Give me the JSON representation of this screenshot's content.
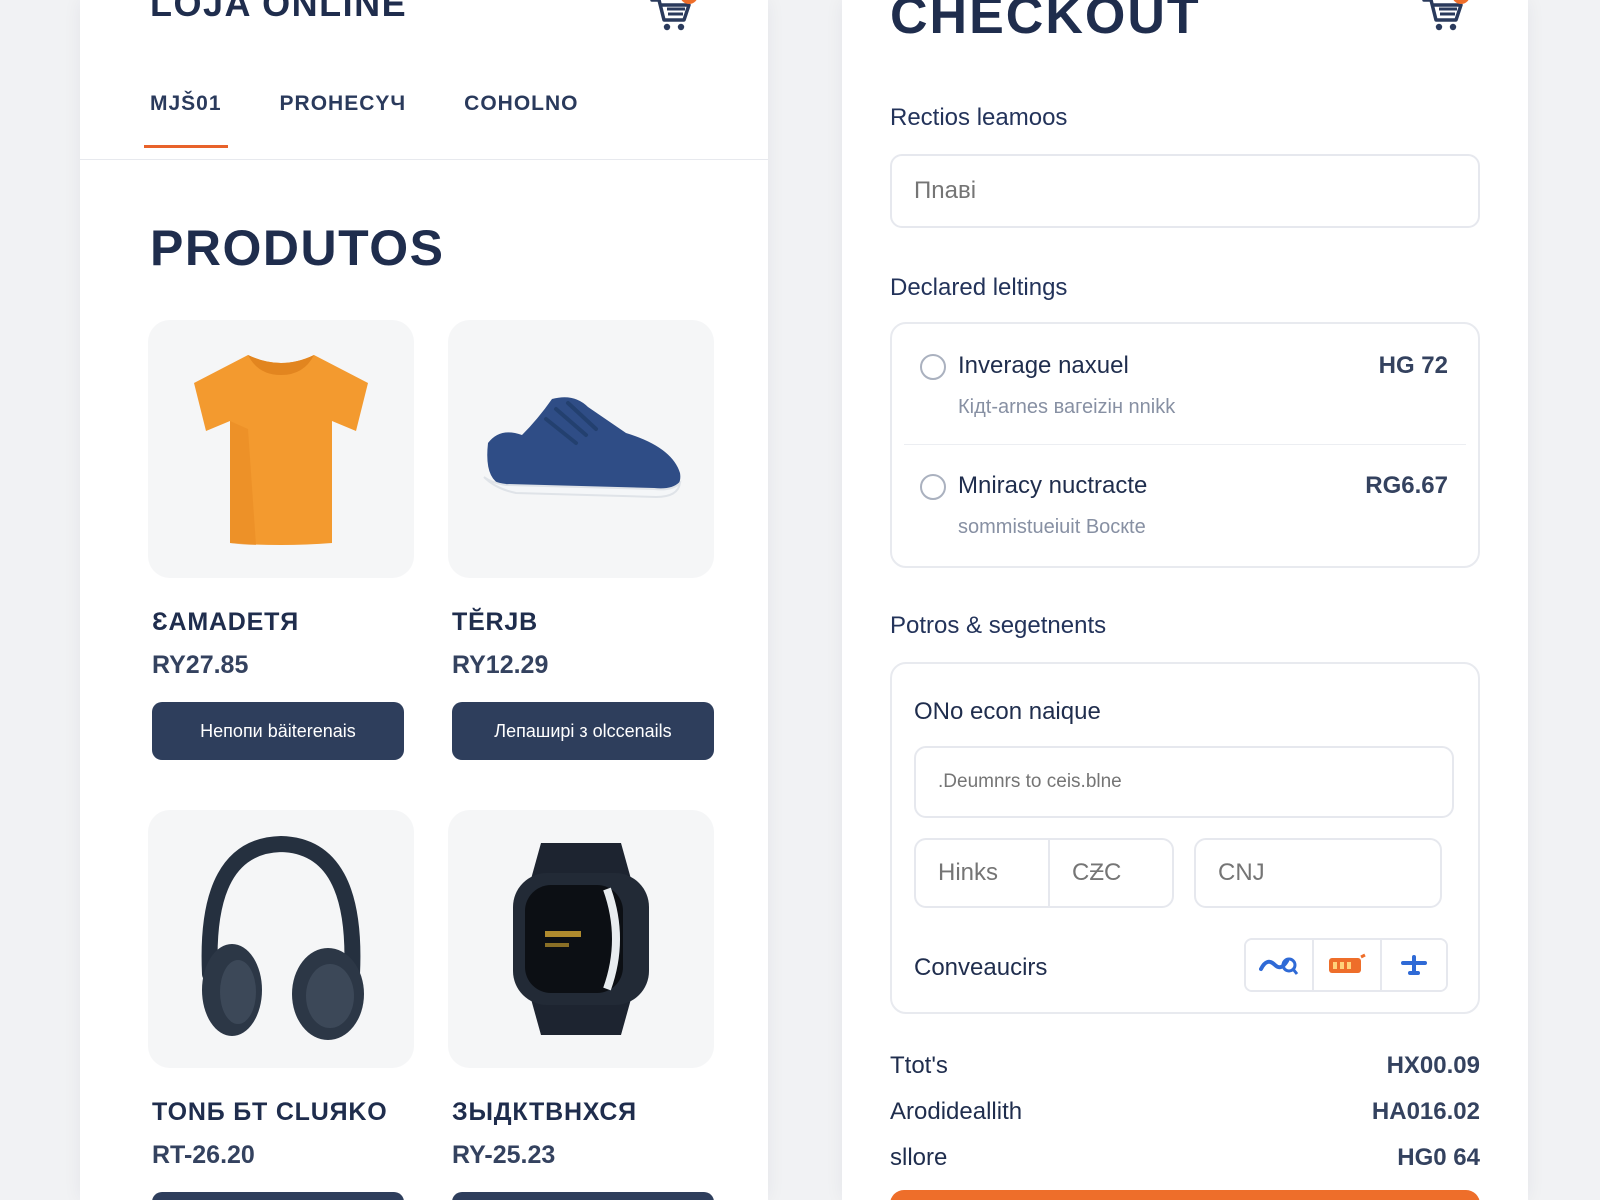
{
  "store": {
    "title": "LOJA ONLINE",
    "cart_count": "1",
    "tabs": [
      {
        "label": "MJŠ01",
        "active": true
      },
      {
        "label": "PROHECYЧ",
        "active": false
      },
      {
        "label": "COHOLNO",
        "active": false
      }
    ],
    "section_title": "PRODUTOS",
    "products": [
      {
        "name": "ƐAMADETЯ",
        "price": "RY27.85",
        "button": "Непопи bäiterenais",
        "image": "orange-tshirt"
      },
      {
        "name": "TĔRJB",
        "price": "RY12.29",
        "button": "Лепаширі з olccenails",
        "image": "blue-sneaker"
      },
      {
        "name": "TONБ БT CLUЯKO",
        "price": "RT-26.20",
        "button": "",
        "image": "headphones"
      },
      {
        "name": "ЗЫДКТВНХСЯ",
        "price": "RY-25.23",
        "button": "",
        "image": "smartwatch"
      }
    ]
  },
  "checkout": {
    "title": "CHECKOUT",
    "cart_count": "1",
    "name_section": {
      "label": "Rectios leamoos",
      "placeholder": "Пnаві"
    },
    "delivery": {
      "label": "Declared leltings",
      "options": [
        {
          "name": "Inverage naxuel",
          "desc": "Кідt-arnes вагеіzін nnikk",
          "price": "HG 72"
        },
        {
          "name": "Mniracy nuctracte",
          "desc": "sommistueiuit Bocкte",
          "price": "RG6.67"
        }
      ]
    },
    "payment": {
      "label": "Potros & segetnents",
      "box_title": "ONo econ naique",
      "card_placeholder": ".Deumnrs to ceis.blne",
      "expiry_placeholder": "Hinks",
      "cvc_placeholder": "CƵC",
      "cnj_placeholder": "CNJ",
      "conveyors_label": "Conveaucirs",
      "card_icons": [
        "card-brand-blue-icon",
        "card-brand-orange-icon",
        "card-brand-plane-icon"
      ]
    },
    "summary": [
      {
        "label": "Ttot's",
        "value": "HX00.09"
      },
      {
        "label": "Arodideallith",
        "value": "HA016.02"
      },
      {
        "label": "sllore",
        "value": "HG0 64"
      }
    ]
  },
  "colors": {
    "accent": "#ee6e2a",
    "navy": "#1f2d4d",
    "button": "#2e3e5c",
    "background": "#f1f2f4"
  }
}
